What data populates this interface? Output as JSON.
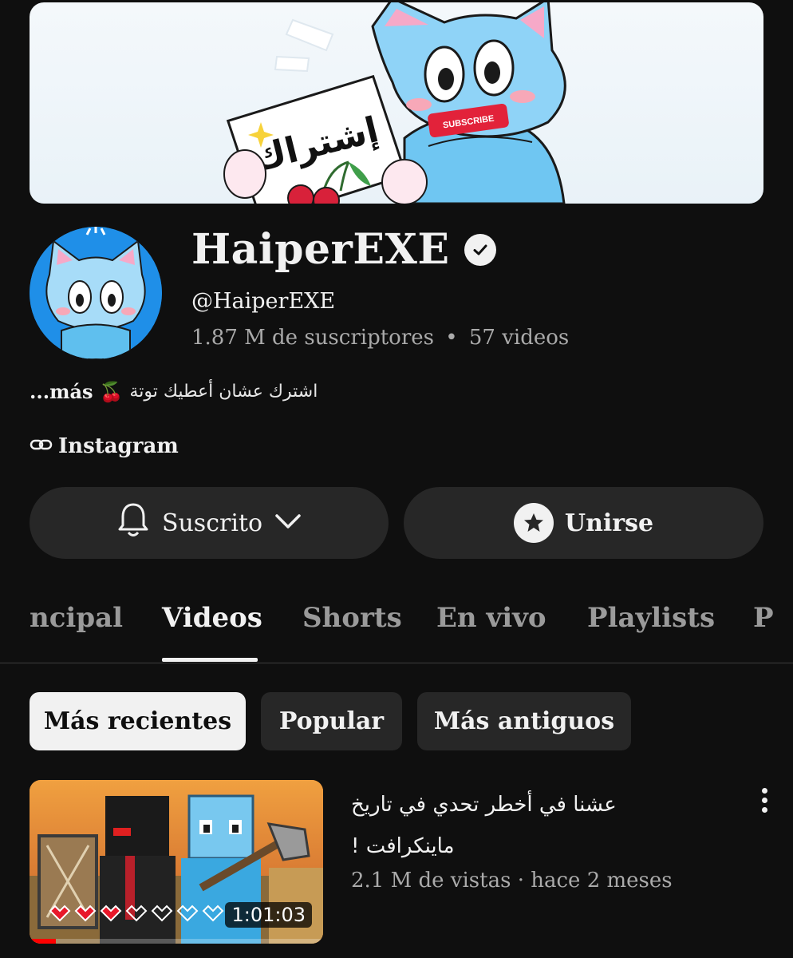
{
  "channel": {
    "name": "HaiperEXE",
    "handle": "@HaiperEXE",
    "subscribers": "1.87 M de suscriptores",
    "separator": "•",
    "video_count": "57 videos",
    "description": "اشترك عشان أعطيك توتة",
    "description_emoji": "🍒",
    "more_label": "...más",
    "link_label": "Instagram"
  },
  "banner": {
    "sign_text": "إشتراك",
    "badge_text": "SUBSCRIBE"
  },
  "actions": {
    "subscribe_label": "Suscrito",
    "join_label": "Unirse"
  },
  "tabs": [
    {
      "label": "ncipal"
    },
    {
      "label": "Videos"
    },
    {
      "label": "Shorts"
    },
    {
      "label": "En vivo"
    },
    {
      "label": "Playlists"
    },
    {
      "label": "P"
    }
  ],
  "active_tab": "Videos",
  "filters": [
    {
      "label": "Más recientes",
      "selected": true
    },
    {
      "label": "Popular",
      "selected": false
    },
    {
      "label": "Más antiguos",
      "selected": false
    }
  ],
  "videos": [
    {
      "title": "عشنا في أخطر تحدي في تاريخ ماينكرافت !",
      "views": "2.1 M de vistas",
      "meta_separator": "·",
      "age": "hace 2 meses",
      "duration": "1:01:03",
      "watched_fraction": 0.09
    }
  ],
  "colors": {
    "background": "#0f0f0f",
    "surface": "#272727",
    "text": "#f1f1f1",
    "muted": "#aaaaaa",
    "progress": "#ff0000"
  },
  "icons": [
    "verified-check-icon",
    "link-icon",
    "bell-icon",
    "chevron-down-icon",
    "star-icon",
    "more-vert-icon"
  ]
}
